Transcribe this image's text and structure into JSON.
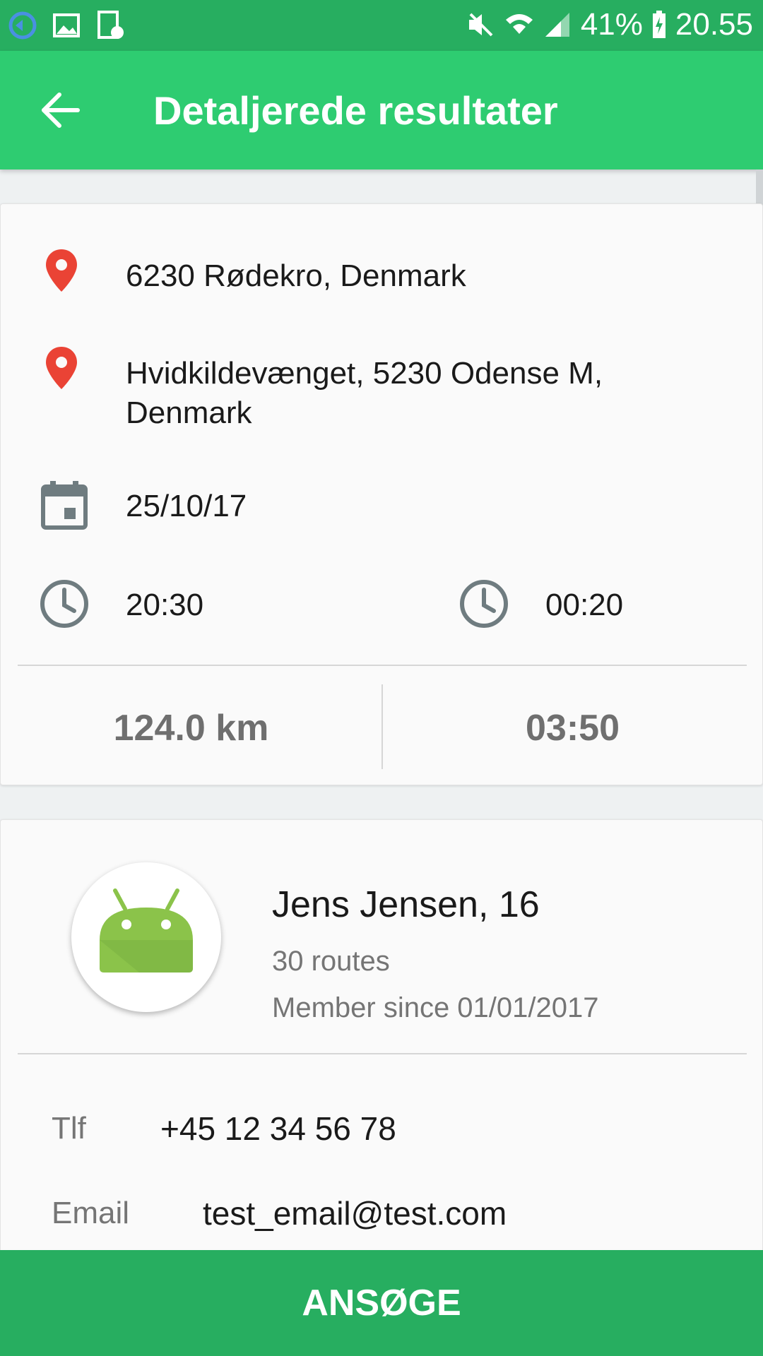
{
  "status_bar": {
    "battery": "41%",
    "time": "20.55",
    "icons": [
      "sync-icon",
      "image-icon",
      "screenshot-icon",
      "mute-icon",
      "wifi-icon",
      "signal-icon",
      "battery-charging-icon"
    ]
  },
  "app_bar": {
    "title": "Detaljerede resultater",
    "back_icon": "arrow-back-icon"
  },
  "trip": {
    "from": "6230 Rødekro, Denmark",
    "to_line1": "Hvidkildevænget, 5230 Odense M,",
    "to_line2": "Denmark",
    "date": "25/10/17",
    "departure_time": "20:30",
    "arrival_time": "00:20",
    "distance": "124.0 km",
    "duration": "03:50"
  },
  "driver": {
    "name": "Jens Jensen, 16",
    "routes": "30 routes",
    "member_since": "Member since 01/01/2017",
    "phone_label": "Tlf",
    "phone": "+45 12 34 56 78",
    "email_label": "Email",
    "email": "test_email@test.com"
  },
  "actions": {
    "apply_label": "ANSØGE"
  },
  "colors": {
    "status_bar": "#27ae60",
    "app_bar": "#2ecc71",
    "button": "#27ae60",
    "pin": "#ea4335",
    "icon_gray": "#6f7c80"
  }
}
